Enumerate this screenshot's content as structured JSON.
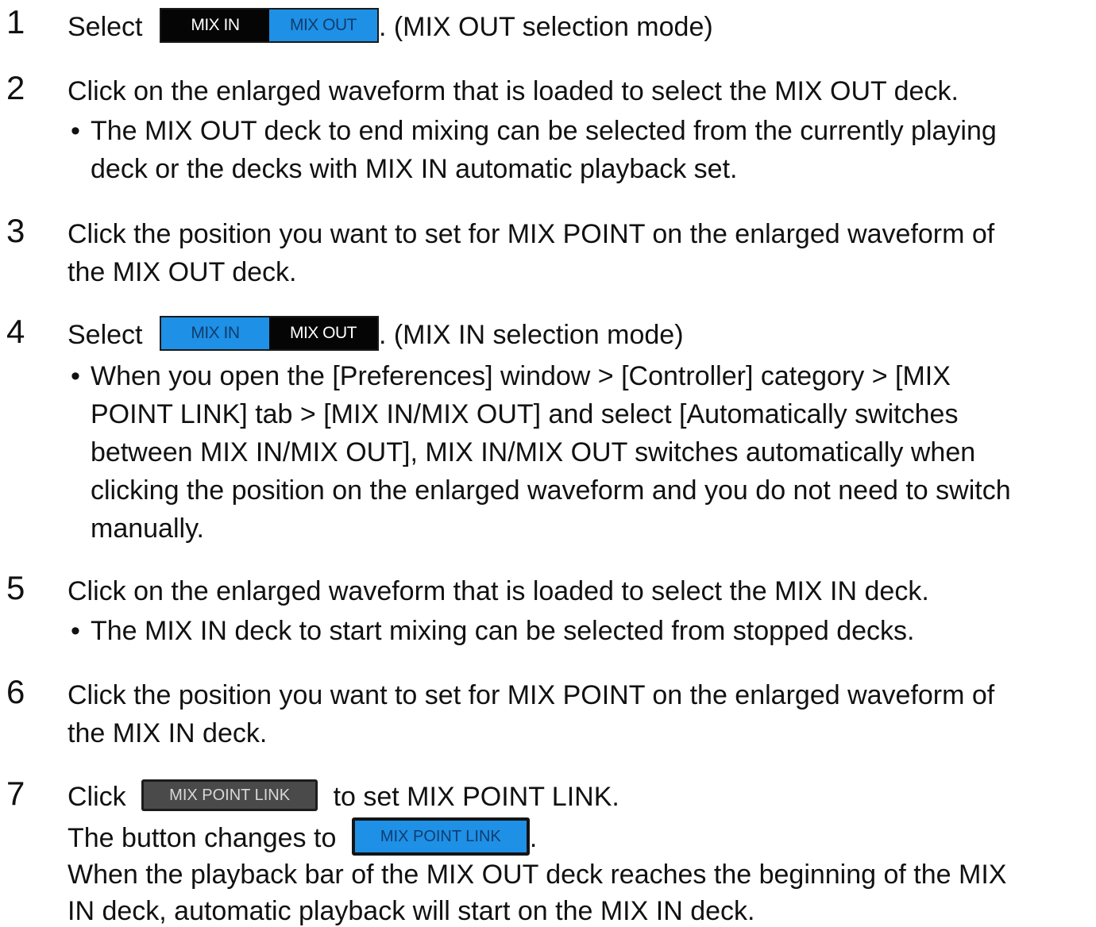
{
  "steps": [
    {
      "num": "1",
      "before": "Select",
      "toggle": {
        "mix_in": "MIX IN",
        "mix_out": "MIX OUT"
      },
      "after": ". (MIX OUT selection mode)"
    },
    {
      "num": "2",
      "text": "Click on the enlarged waveform that is loaded to select the MIX OUT deck.",
      "bullet_lines": [
        "The MIX OUT deck to end mixing can be selected from the currently playing",
        "deck or the decks with MIX IN automatic playback set."
      ]
    },
    {
      "num": "3",
      "lines": [
        "Click the position you want to set for MIX POINT on the enlarged waveform of",
        "the MIX OUT deck."
      ]
    },
    {
      "num": "4",
      "before": "Select",
      "toggle": {
        "mix_in": "MIX IN",
        "mix_out": "MIX OUT"
      },
      "after": ". (MIX IN selection mode)",
      "bullet_lines": [
        "When you open the [Preferences] window > [Controller] category > [MIX",
        "POINT LINK] tab > [MIX IN/MIX OUT] and select [Automatically switches",
        "between MIX IN/MIX OUT], MIX IN/MIX OUT switches automatically when",
        "clicking the position on the enlarged waveform and you do not need to switch",
        "manually."
      ]
    },
    {
      "num": "5",
      "text": "Click on the enlarged waveform that is loaded to select the MIX IN deck.",
      "bullet_lines": [
        "The MIX IN deck to start mixing can be selected from stopped decks."
      ]
    },
    {
      "num": "6",
      "lines": [
        "Click the position you want to set for MIX POINT on the enlarged waveform of",
        "the MIX IN deck."
      ]
    },
    {
      "num": "7",
      "before": "Click",
      "button_off": "MIX POINT LINK",
      "after": "to set MIX POINT LINK.",
      "line2_before": "The button changes to",
      "button_on": "MIX POINT LINK",
      "line2_after": ".",
      "lines": [
        "When the playback bar of the MIX OUT deck reaches the beginning of the MIX",
        "IN deck, automatic playback will start on the MIX IN deck."
      ]
    }
  ],
  "bullet_char": "•",
  "colors": {
    "active_blue": "#1e90e6",
    "button_dark": "#4a4a4a"
  }
}
